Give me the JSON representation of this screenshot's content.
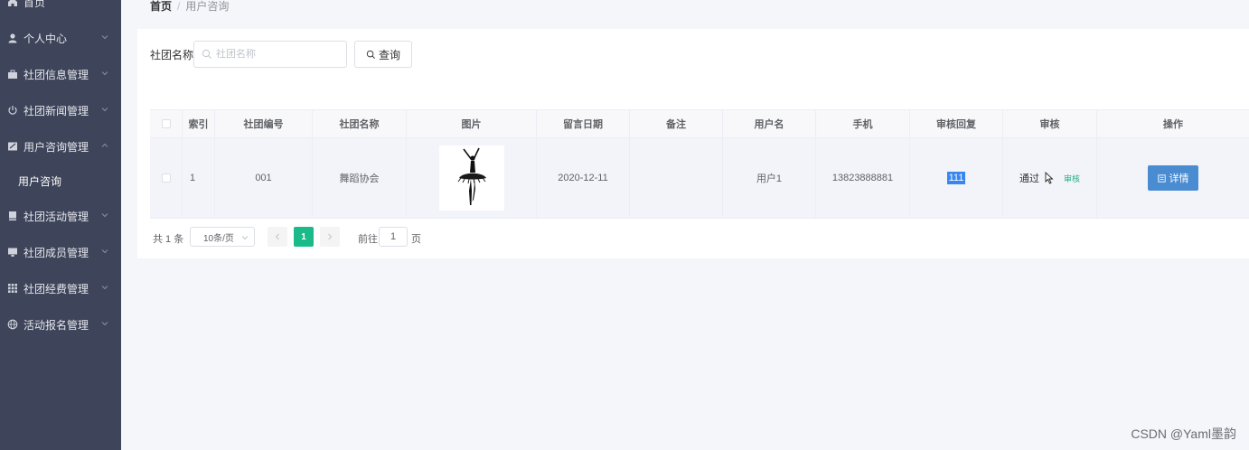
{
  "sidebar": {
    "items": [
      {
        "label": "首页",
        "icon": "home-icon"
      },
      {
        "label": "个人中心",
        "icon": "user-icon"
      },
      {
        "label": "社团信息管理",
        "icon": "briefcase-icon"
      },
      {
        "label": "社团新闻管理",
        "icon": "power-icon"
      },
      {
        "label": "用户咨询管理",
        "icon": "edit-icon"
      },
      {
        "label": "社团活动管理",
        "icon": "book-icon"
      },
      {
        "label": "社团成员管理",
        "icon": "monitor-icon"
      },
      {
        "label": "社团经费管理",
        "icon": "grid-icon"
      },
      {
        "label": "活动报名管理",
        "icon": "globe-icon"
      }
    ],
    "submenu": {
      "label": "用户咨询"
    }
  },
  "breadcrumb": {
    "home": "首页",
    "separator": "/",
    "current": "用户咨询"
  },
  "search": {
    "label": "社团名称",
    "placeholder": "社团名称",
    "value": "",
    "button_label": "查询"
  },
  "table": {
    "headers": [
      "索引",
      "社团编号",
      "社团名称",
      "图片",
      "留言日期",
      "备注",
      "用户名",
      "手机",
      "审核回复",
      "审核",
      "操作"
    ],
    "rows": [
      {
        "index": "1",
        "club_no": "001",
        "club_name": "舞蹈协会",
        "date": "2020-12-11",
        "remark": "",
        "username": "用户1",
        "phone": "13823888881",
        "reply": "111",
        "audit_status": "通过",
        "audit_action": "审核",
        "detail_label": "详情"
      }
    ]
  },
  "pagination": {
    "total": "共 1 条",
    "page_size": "10条/页",
    "current_page": "1",
    "goto_label": "前往",
    "goto_value": "1",
    "page_suffix": "页"
  },
  "watermark": "CSDN @Yaml墨韵",
  "colors": {
    "sidebar_bg": "#3e4459",
    "accent": "#1aba8a",
    "detail_button": "#4a8cd2",
    "reply_highlight": "#3a86f0"
  }
}
